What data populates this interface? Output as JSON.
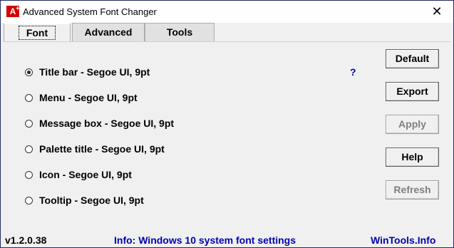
{
  "window": {
    "title": "Advanced System Font Changer",
    "icon_label": "A",
    "icon_plus": "+",
    "close_glyph": "✕"
  },
  "tabs": [
    {
      "label": "Font",
      "active": true
    },
    {
      "label": "Advanced",
      "active": false
    },
    {
      "label": "Tools",
      "active": false
    }
  ],
  "options": [
    {
      "label": "Title bar - Segoe UI, 9pt",
      "checked": true
    },
    {
      "label": "Menu - Segoe UI, 9pt",
      "checked": false
    },
    {
      "label": "Message box - Segoe UI, 9pt",
      "checked": false
    },
    {
      "label": "Palette title - Segoe UI, 9pt",
      "checked": false
    },
    {
      "label": "Icon - Segoe UI, 9pt",
      "checked": false
    },
    {
      "label": "Tooltip - Segoe UI, 9pt",
      "checked": false
    }
  ],
  "help_mark": "?",
  "buttons": {
    "default": "Default",
    "export": "Export",
    "apply": "Apply",
    "help": "Help",
    "refresh": "Refresh"
  },
  "footer": {
    "version": "v1.2.0.38",
    "info": "Info: Windows 10 system font settings",
    "site": "WinTools.Info"
  },
  "colors": {
    "accent_link": "#0000b4",
    "icon_red": "#d40000",
    "window_border": "#1f2a6b"
  }
}
